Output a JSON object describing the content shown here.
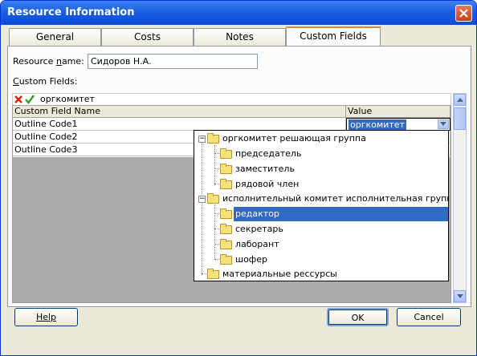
{
  "window": {
    "title": "Resource Information"
  },
  "tabs": [
    {
      "label": "General"
    },
    {
      "label": "Costs"
    },
    {
      "label": "Notes"
    },
    {
      "label": "Custom Fields",
      "active": true
    }
  ],
  "form": {
    "resource_name_label": "Resource name:",
    "resource_name_value": "Сидоров Н.А.",
    "custom_fields_label": "Custom Fields:"
  },
  "entry_bar": {
    "value": "оргкомитет"
  },
  "grid": {
    "headers": [
      "Custom Field Name",
      "Value"
    ],
    "rows": [
      {
        "name": "Outline Code1",
        "value": "оргкомитет"
      },
      {
        "name": "Outline Code2",
        "value": ""
      },
      {
        "name": "Outline Code3",
        "value": ""
      }
    ]
  },
  "tree": {
    "items": [
      {
        "label": "оргкомитет  решающая группа",
        "level": 0,
        "expander": "minus"
      },
      {
        "label": "председатель",
        "level": 1
      },
      {
        "label": "заместитель",
        "level": 1
      },
      {
        "label": "рядовой член",
        "level": 1
      },
      {
        "label": "исполнительный комитет  исполнительная группа",
        "level": 0,
        "expander": "minus"
      },
      {
        "label": "редактор",
        "level": 1,
        "selected": true
      },
      {
        "label": "секретарь",
        "level": 1
      },
      {
        "label": "лаборант",
        "level": 1
      },
      {
        "label": "шофер",
        "level": 1
      },
      {
        "label": "материальные рессурсы",
        "level": 0
      }
    ]
  },
  "buttons": {
    "help": "Help",
    "ok": "OK",
    "cancel": "Cancel"
  },
  "colors": {
    "titlebar": "#0a4ad6",
    "selection": "#316ac5",
    "close": "#c8401f"
  }
}
